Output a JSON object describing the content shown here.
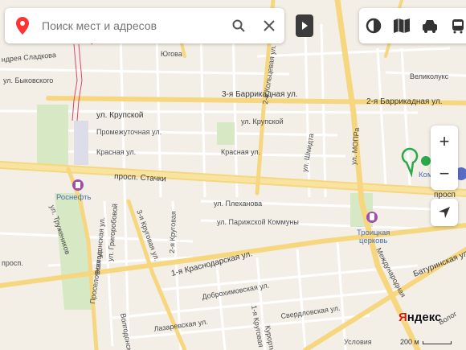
{
  "search": {
    "placeholder": "Поиск мест и адресов"
  },
  "toolbar": {
    "layers_icon": "layers-icon",
    "routes_icon": "routes-icon",
    "traffic_icon": "traffic-icon",
    "transport_icon": "transport-icon"
  },
  "zoom": {
    "in_label": "+",
    "out_label": "−"
  },
  "branding": {
    "logo_y": "Я",
    "logo_rest": "ндекс",
    "scale": "200 м",
    "conditions": "Условия"
  },
  "streets": {
    "sladkova": "ндрея Сладкова",
    "yugova": "Югова",
    "koltsevaya": "2-я Кольцевая ул.",
    "bykovskogo": "ул. Быковского",
    "barrikadnaya3": "3-я Баррикадная ул.",
    "barrikadnaya2": "2-я Баррикадная ул.",
    "velikolukskaya": "Великолукс",
    "krupskoy1": "ул. Крупской",
    "krupskoy2": "ул. Крупской",
    "promezhutochnaya": "Промежуточная ул.",
    "krasnaya1": "Красная ул.",
    "krasnaya2": "Красная ул.",
    "shmidta": "ул. Шмидта",
    "mopra": "ул. МОПРа",
    "stachki1": "просп. Стачки",
    "stachki2": "просп",
    "plekhanova": "ул. Плеханова",
    "parizhskoy": "ул. Парижской Коммуны",
    "grigorobovoy": "ул. Григоробовой",
    "volgodonskaya1": "Волгодонская ул.",
    "proselochnaya": "Проселочная ул.",
    "krugovaya3": "3-я Круговая ул.",
    "krugovaya2": "2-я Круговая",
    "truzhenikov": "ул. Тружеников",
    "prosp_left": "просп.",
    "krasnodarskaya": "1-я Краснодарская ул.",
    "dobrokhimovskaya": "Доброхимовская ул.",
    "sverdlovskaya": "Свердловская ул.",
    "mezhdunarodnaya": "Международная",
    "baturinskaya": "Батуринская ул.",
    "lazarevskaya": "Лазаревская ул.",
    "krugovaya1": "1-я Круговая",
    "volgodonskaya2": "Волгодонская",
    "kurortnaya": "Курортная",
    "volog": "Волог"
  },
  "poi": {
    "rosneft": "Роснефть",
    "troitskaya1": "Троицкая",
    "troitskaya2": "церковь",
    "metro_label": "Ком"
  }
}
